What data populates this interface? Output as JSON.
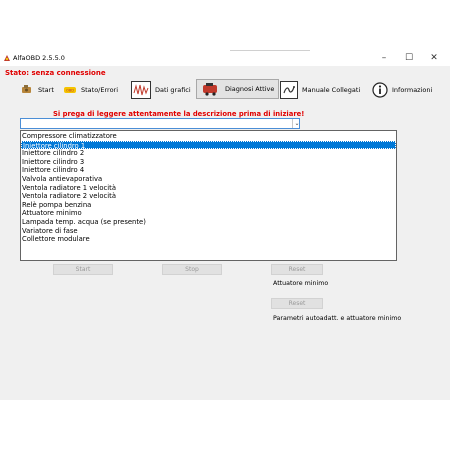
{
  "window": {
    "title": "AlfaOBD 2.5.5.0",
    "controls": {
      "minimize": "–",
      "maximize": "☐",
      "close": "✕"
    }
  },
  "status": {
    "text": "Stato: senza connessione",
    "color": "#e00000"
  },
  "toolbar": {
    "items": [
      {
        "label": "Start",
        "icon": "engine-icon"
      },
      {
        "label": "Stato/Errori",
        "icon": "check-engine-icon"
      },
      {
        "label": "Dati grafici",
        "icon": "waveform-icon"
      },
      {
        "label": "Diagnosi Attive",
        "icon": "car-engine-icon",
        "active": true
      },
      {
        "label": "Manuale Collegati",
        "icon": "manual-icon"
      },
      {
        "label": "Informazioni",
        "icon": "info-icon"
      }
    ]
  },
  "notice": {
    "text": "Si prega di leggere attentamente la descrizione prima di iniziare!"
  },
  "combo": {
    "value": ""
  },
  "dropdown": {
    "selected_index": 1,
    "options": [
      "Compressore climatizzatore",
      "Iniettore cilindro 1",
      "Iniettore cilindro 2",
      "Iniettore cilindro 3",
      "Iniettore cilindro 4",
      "Valvola antievaporativa",
      "Ventola radiatore 1 velocità",
      "Ventola radiatore 2 velocità",
      "Relè pompa benzina",
      "Attuatore minimo",
      "Lampada temp. acqua (se presente)",
      "Variatore di fase",
      "Collettore modulare"
    ]
  },
  "buttons": {
    "start": "Start",
    "stop": "Stop",
    "reset1": "Reset",
    "reset2": "Reset"
  },
  "labels": {
    "attuatore": "Attuatore minimo",
    "parametri": "Parametri autoadatt. e attuatore minimo"
  },
  "colors": {
    "accent": "#0078d7",
    "warning": "#e00000"
  }
}
